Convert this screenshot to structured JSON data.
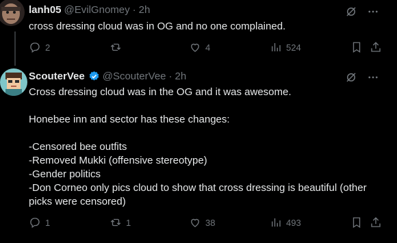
{
  "tweets": [
    {
      "display_name": "lanh05",
      "handle": "@EvilGnomey",
      "separator": "·",
      "time": "2h",
      "verified": false,
      "body_lines": [
        "cross dressing cloud was in OG and no one complained."
      ],
      "actions": {
        "replies": "2",
        "reposts": "",
        "likes": "4",
        "views": "524"
      },
      "avatar_colors": {
        "bg": "#3a2e2a",
        "skin": "#b08a74"
      }
    },
    {
      "display_name": "ScouterVee",
      "handle": "@ScouterVee",
      "separator": "·",
      "time": "2h",
      "verified": true,
      "body_lines": [
        "Cross dressing cloud was in the OG and it was awesome.",
        "",
        "Honebee inn and sector has these changes:",
        "",
        "-Censored bee outfits",
        "-Removed Mukki (offensive stereotype)",
        "-Gender politics",
        "-Don Corneo only pics cloud to show that cross dressing is beautiful (other picks were censored)"
      ],
      "actions": {
        "replies": "1",
        "reposts": "1",
        "likes": "38",
        "views": "493"
      },
      "avatar_colors": {
        "bg": "#7fc6c9",
        "skin": "#f0c8a0"
      }
    }
  ],
  "colors": {
    "background": "#000000",
    "text": "#e7e9ea",
    "muted": "#71767b",
    "verified": "#1d9bf0",
    "divider": "#2f3336"
  },
  "icons": [
    "grok-icon",
    "more-icon",
    "reply-icon",
    "repost-icon",
    "like-icon",
    "views-icon",
    "bookmark-icon",
    "share-icon",
    "verified-badge-icon"
  ]
}
